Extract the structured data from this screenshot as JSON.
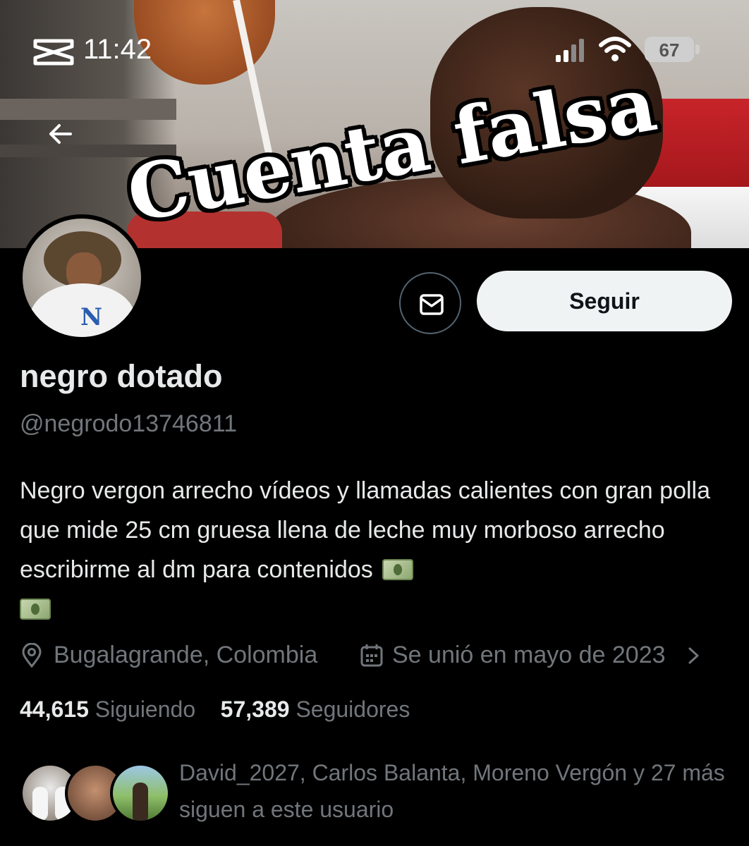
{
  "status_bar": {
    "time": "11:42",
    "battery": "67",
    "icons": [
      "capcut-icon",
      "signal-icon",
      "wifi-icon",
      "battery-icon"
    ]
  },
  "banner": {
    "overlay_text": "Cuenta falsa"
  },
  "profile": {
    "display_name": "negro dotado",
    "handle": "@negrodo13746811",
    "bio": "Negro vergon arrecho vídeos y llamadas calientes con gran polla que mide 25 cm gruesa llena de leche muy morboso arrecho escribirme al dm para contenidos",
    "bio_emoji": [
      "money-with-wings-emoji",
      "money-with-wings-emoji"
    ],
    "location": "Bugalagrande, Colombia",
    "joined": "Se unió en mayo de 2023",
    "following_count": "44,615",
    "following_label": "Siguiendo",
    "followers_count": "57,389",
    "followers_label": "Seguidores",
    "known_followers_text": "David_2027, Carlos Balanta, Moreno Vergón y 27 más siguen a este usuario"
  },
  "actions": {
    "follow_label": "Seguir",
    "message_icon": "envelope-icon",
    "back_icon": "arrow-left-icon"
  },
  "colors": {
    "background": "#000000",
    "primary_text": "#e7e9ea",
    "secondary_text": "#71767b",
    "follow_button_bg": "#eff3f4"
  }
}
